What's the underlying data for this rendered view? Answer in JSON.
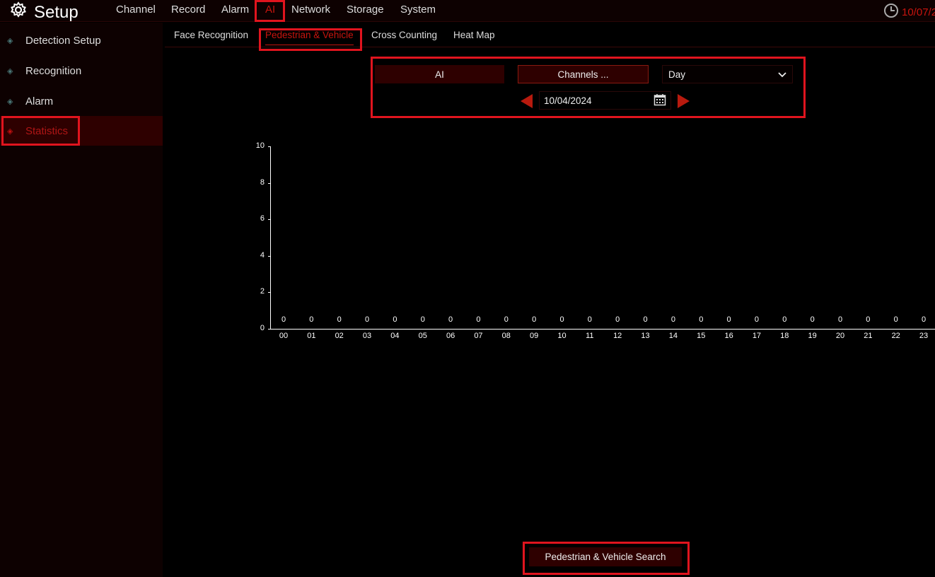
{
  "header": {
    "title": "Setup",
    "nav": [
      "Channel",
      "Record",
      "Alarm",
      "AI",
      "Network",
      "Storage",
      "System"
    ],
    "active_nav": "AI",
    "datetime": "10/07/2"
  },
  "sidebar": {
    "items": [
      {
        "label": "Detection Setup"
      },
      {
        "label": "Recognition"
      },
      {
        "label": "Alarm"
      },
      {
        "label": "Statistics",
        "active": true
      }
    ]
  },
  "tabs": {
    "items": [
      "Face Recognition",
      "Pedestrian & Vehicle",
      "Cross Counting",
      "Heat Map"
    ],
    "active": "Pedestrian & Vehicle"
  },
  "controls": {
    "type_label": "AI",
    "channels_label": "Channels ...",
    "period": "Day",
    "date": "10/04/2024"
  },
  "footer": {
    "search_label": "Pedestrian & Vehicle Search"
  },
  "colors": {
    "accent": "#c8140e",
    "highlight": "#e0141e",
    "active_bg": "#2e0000"
  },
  "chart_data": {
    "type": "bar",
    "categories": [
      "00",
      "01",
      "02",
      "03",
      "04",
      "05",
      "06",
      "07",
      "08",
      "09",
      "10",
      "11",
      "12",
      "13",
      "14",
      "15",
      "16",
      "17",
      "18",
      "19",
      "20",
      "21",
      "22",
      "23"
    ],
    "values": [
      0,
      0,
      0,
      0,
      0,
      0,
      0,
      0,
      0,
      0,
      0,
      0,
      0,
      0,
      0,
      0,
      0,
      0,
      0,
      0,
      0,
      0,
      0,
      0
    ],
    "yticks": [
      "0",
      "2",
      "4",
      "6",
      "8",
      "10"
    ],
    "ylim": [
      0,
      10
    ]
  }
}
